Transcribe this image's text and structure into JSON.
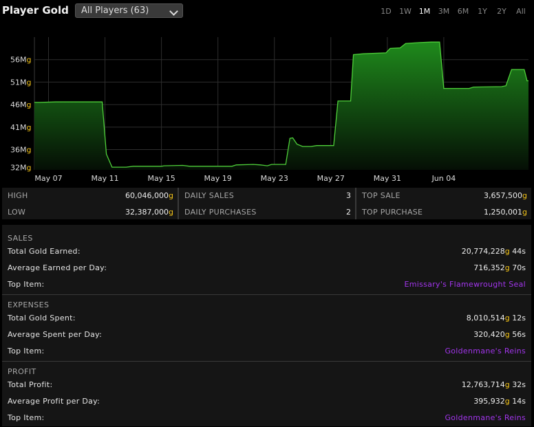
{
  "header": {
    "title": "Player Gold",
    "filter_value": "All Players (63)",
    "ranges": [
      "1D",
      "1W",
      "1M",
      "3M",
      "6M",
      "1Y",
      "2Y",
      "All"
    ],
    "active_range": "1M"
  },
  "chart_data": {
    "type": "area",
    "x_tick_labels": [
      "May 07",
      "May 11",
      "May 15",
      "May 19",
      "May 23",
      "May 27",
      "May 31",
      "Jun 04"
    ],
    "y_tick_labels": [
      "56M",
      "51M",
      "46M",
      "41M",
      "36M",
      "32M"
    ],
    "y_tick_suffix": "g",
    "ylim": [
      31.5,
      61
    ],
    "grid": true,
    "colors": {
      "line": "#4fd13a",
      "fill_top": "#1f8a1c",
      "fill_bottom": "#050f05"
    },
    "points": [
      [
        6.0,
        46.5
      ],
      [
        6.4,
        46.5
      ],
      [
        7.5,
        46.6
      ],
      [
        8.5,
        46.6
      ],
      [
        10.5,
        46.6
      ],
      [
        10.8,
        46.6
      ],
      [
        11.1,
        35
      ],
      [
        11.5,
        32.1
      ],
      [
        12.5,
        32.1
      ],
      [
        13,
        32.3
      ],
      [
        15,
        32.3
      ],
      [
        15.2,
        32.4
      ],
      [
        16.5,
        32.5
      ],
      [
        17,
        32.3
      ],
      [
        20,
        32.3
      ],
      [
        20.3,
        32.6
      ],
      [
        21.5,
        32.7
      ],
      [
        22,
        32.6
      ],
      [
        22.5,
        32.4
      ],
      [
        22.8,
        32.7
      ],
      [
        23.8,
        32.7
      ],
      [
        24.1,
        38.5
      ],
      [
        24.3,
        38.6
      ],
      [
        24.6,
        37.2
      ],
      [
        25,
        36.7
      ],
      [
        25.6,
        36.7
      ],
      [
        26,
        36.9
      ],
      [
        27.2,
        36.9
      ],
      [
        27.5,
        46.8
      ],
      [
        28.4,
        46.8
      ],
      [
        28.6,
        57.1
      ],
      [
        29.3,
        57.3
      ],
      [
        30.9,
        57.5
      ],
      [
        31.2,
        58.5
      ],
      [
        31.9,
        58.6
      ],
      [
        32.3,
        59.6
      ],
      [
        33.3,
        59.8
      ],
      [
        34.1,
        59.9
      ],
      [
        34.7,
        59.9
      ],
      [
        35.0,
        49.6
      ],
      [
        36.8,
        49.6
      ],
      [
        37.1,
        49.9
      ],
      [
        39.1,
        50.0
      ],
      [
        39.4,
        50.2
      ],
      [
        39.8,
        53.8
      ],
      [
        40.7,
        53.8
      ],
      [
        40.9,
        51.3
      ],
      [
        41.0,
        51.3
      ]
    ]
  },
  "stats": {
    "high_label": "HIGH",
    "high_value": "60,046,000",
    "high_unit": "g",
    "low_label": "LOW",
    "low_value": "32,387,000",
    "low_unit": "g",
    "daily_sales_label": "DAILY SALES",
    "daily_sales_value": "3",
    "daily_purchases_label": "DAILY PURCHASES",
    "daily_purchases_value": "2",
    "top_sale_label": "TOP SALE",
    "top_sale_value": "3,657,500",
    "top_sale_unit": "g",
    "top_purchase_label": "TOP PURCHASE",
    "top_purchase_value": "1,250,001",
    "top_purchase_unit": "g"
  },
  "sales": {
    "title": "SALES",
    "total_label": "Total Gold Earned:",
    "total_gold": "20,774,228",
    "total_g": "g",
    "total_silver": "44",
    "total_s": "s",
    "avg_label": "Average Earned per Day:",
    "avg_gold": "716,352",
    "avg_g": "g",
    "avg_silver": "70",
    "avg_s": "s",
    "top_label": "Top Item:",
    "top_item": "Emissary's Flamewrought Seal"
  },
  "expenses": {
    "title": "EXPENSES",
    "total_label": "Total Gold Spent:",
    "total_gold": "8,010,514",
    "total_g": "g",
    "total_silver": "12",
    "total_s": "s",
    "avg_label": "Average Spent per Day:",
    "avg_gold": "320,420",
    "avg_g": "g",
    "avg_silver": "56",
    "avg_s": "s",
    "top_label": "Top Item:",
    "top_item": "Goldenmane's Reins"
  },
  "profit": {
    "title": "PROFIT",
    "total_label": "Total Profit:",
    "total_gold": "12,763,714",
    "total_g": "g",
    "total_silver": "32",
    "total_s": "s",
    "avg_label": "Average Profit per Day:",
    "avg_gold": "395,932",
    "avg_g": "g",
    "avg_silver": "14",
    "avg_s": "s",
    "top_label": "Top Item:",
    "top_item": "Goldenmane's Reins"
  }
}
